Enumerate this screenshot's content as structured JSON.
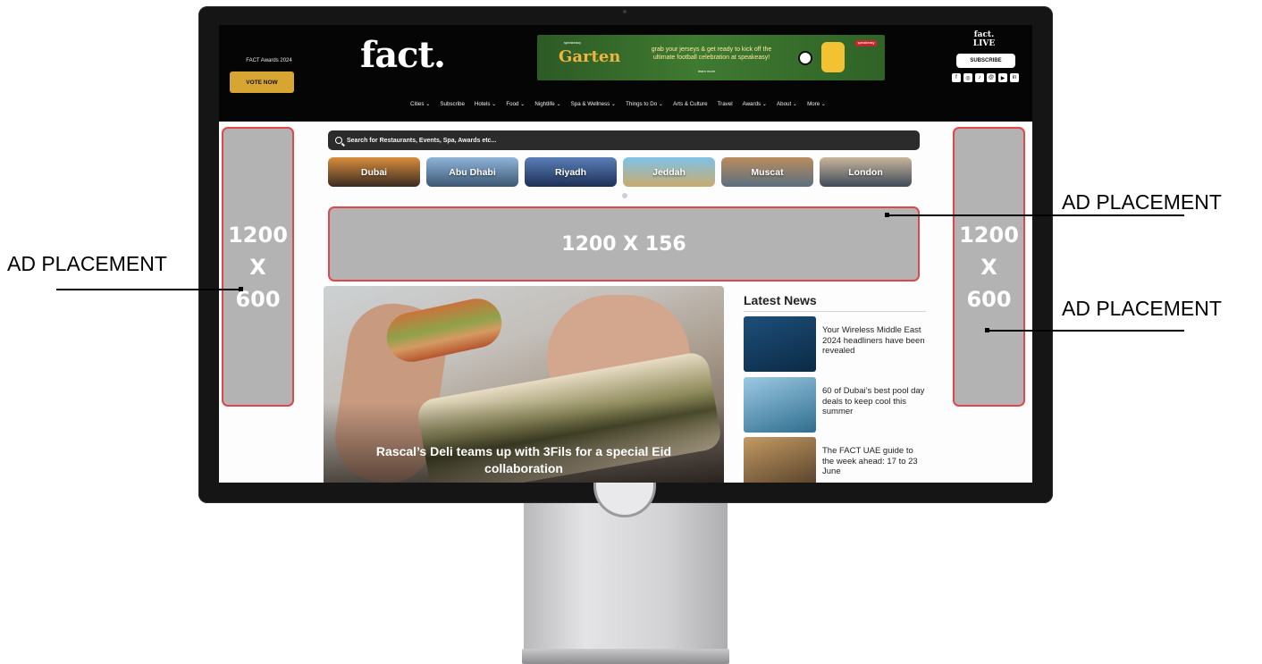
{
  "header": {
    "awards_text": "FACT Awards 2024",
    "vote_label": "VOTE NOW",
    "logo_text": "fact.",
    "live_logo": "fact. LIVE",
    "subscribe_label": "SUBSCRIBE",
    "social_icons": [
      "facebook-icon",
      "instagram-icon",
      "tiktok-icon",
      "threads-icon",
      "youtube-icon",
      "linkedin-icon"
    ]
  },
  "banner": {
    "brand_sub": "speakeasy",
    "brand": "Garten",
    "text": "grab your jerseys & get ready to kick off the ultimate football celebration at speakeasy!",
    "learn": "learn more",
    "tag": "speakeasy"
  },
  "nav": {
    "items": [
      "Cities ⌄",
      "Subscribe",
      "Hotels ⌄",
      "Food ⌄",
      "Nightlife ⌄",
      "Spa & Wellness ⌄",
      "Things to Do ⌄",
      "Arts & Culture",
      "Travel",
      "Awards ⌄",
      "About ⌄",
      "More ⌄"
    ]
  },
  "search": {
    "placeholder": "Search for Restaurants, Events, Spa, Awards etc..."
  },
  "cities": [
    {
      "label": "Dubai",
      "color_a": "#d98d3c",
      "color_b": "#3a2a22"
    },
    {
      "label": "Abu Dhabi",
      "color_a": "#8fb4d8",
      "color_b": "#3b5773"
    },
    {
      "label": "Riyadh",
      "color_a": "#5a7fb8",
      "color_b": "#1d2f55"
    },
    {
      "label": "Jeddah",
      "color_a": "#7fc2e6",
      "color_b": "#c9ab6e"
    },
    {
      "label": "Muscat",
      "color_a": "#b98c5e",
      "color_b": "#5b6f80"
    },
    {
      "label": "London",
      "color_a": "#c9b59a",
      "color_b": "#3f4a5a"
    }
  ],
  "ads": {
    "side_left": [
      "1200",
      "X",
      "600"
    ],
    "side_right": [
      "1200",
      "X",
      "600"
    ],
    "leaderboard": "1200 X 156"
  },
  "feature": {
    "title": "Rascal’s Deli teams up with 3Fils for a special Eid collaboration"
  },
  "latest_news": {
    "heading": "Latest News",
    "items": [
      {
        "text": "Your Wireless Middle East 2024 headliners have been revealed",
        "thumb_a": "#1d4f7a",
        "thumb_b": "#0b2a45"
      },
      {
        "text": "60 of Dubai’s best pool day deals to keep cool this summer",
        "thumb_a": "#9cc9e3",
        "thumb_b": "#2f6e8f"
      },
      {
        "text": "The FACT UAE guide to the week ahead: 17 to 23 June",
        "thumb_a": "#c39a63",
        "thumb_b": "#4e3a26"
      }
    ]
  },
  "annotations": {
    "left": "AD PLACEMENT",
    "right_top": "AD PLACEMENT",
    "right_bottom": "AD PLACEMENT"
  }
}
